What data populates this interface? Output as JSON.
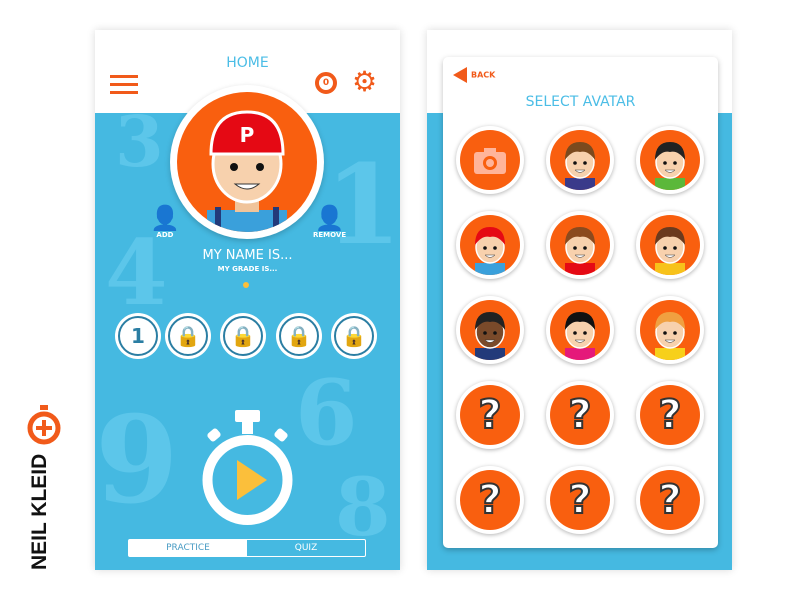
{
  "brand": {
    "name": "NEIL KLEID",
    "logo": "stopwatch-plus-logo"
  },
  "home": {
    "title": "HOME",
    "award_count": "0",
    "add_label": "ADD",
    "remove_label": "REMOVE",
    "name_text": "MY NAME IS...",
    "grade_text": "MY GRADE IS...",
    "levels": [
      {
        "label": "1",
        "locked": false
      },
      {
        "label": "",
        "locked": true
      },
      {
        "label": "",
        "locked": true
      },
      {
        "label": "",
        "locked": true
      },
      {
        "label": "",
        "locked": true
      }
    ],
    "tabs": [
      {
        "label": "PRACTICE",
        "active": true
      },
      {
        "label": "QUIZ",
        "active": false
      }
    ]
  },
  "avatar_screen": {
    "back_label": "BACK",
    "title": "SELECT AVATAR",
    "avatars": [
      "camera",
      "girl-pigtails",
      "boy-black-hair",
      "boy-red-cap",
      "boy-brown-hair",
      "girl-long-hair",
      "boy-dark-skin",
      "girl-black-hair",
      "boy-blond",
      "unknown",
      "unknown",
      "unknown",
      "unknown",
      "unknown",
      "unknown"
    ],
    "unknown_glyph": "?"
  },
  "colors": {
    "accent": "#f15a1a",
    "avatar_bg": "#f95f0f",
    "background": "#45b9e1",
    "title": "#4bbde6",
    "play": "#fbbf3b"
  }
}
